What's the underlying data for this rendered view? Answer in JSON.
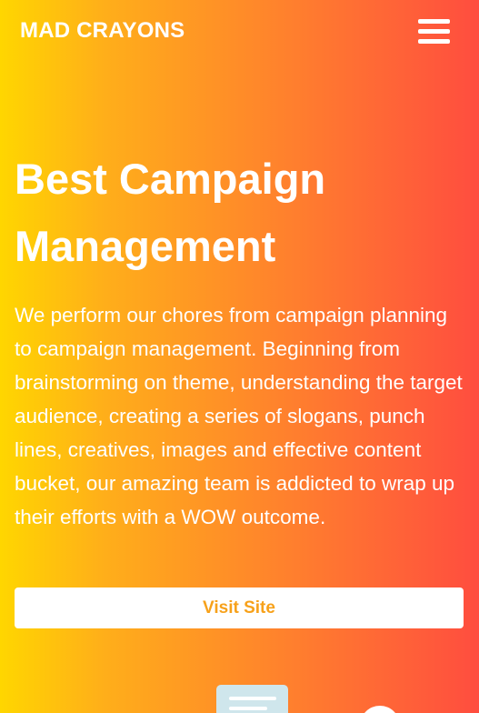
{
  "header": {
    "brand": "MAD CRAYONS",
    "menu_icon": "hamburger-menu-icon"
  },
  "hero": {
    "title": "Best Campaign Management",
    "description": "We perform our chores from campaign planning to campaign management. Beginning from brainstorming on theme, understanding the target audience, creating a series of slogans, punch lines, creatives, images and effective content bucket, our amazing team is addicted to wrap up their efforts with a WOW outcome.",
    "button_label": "Visit Site"
  },
  "colors": {
    "gradient_start": "#ffd600",
    "gradient_end": "#ff4d3f",
    "button_text": "#f7a11a",
    "text": "#ffffff"
  }
}
